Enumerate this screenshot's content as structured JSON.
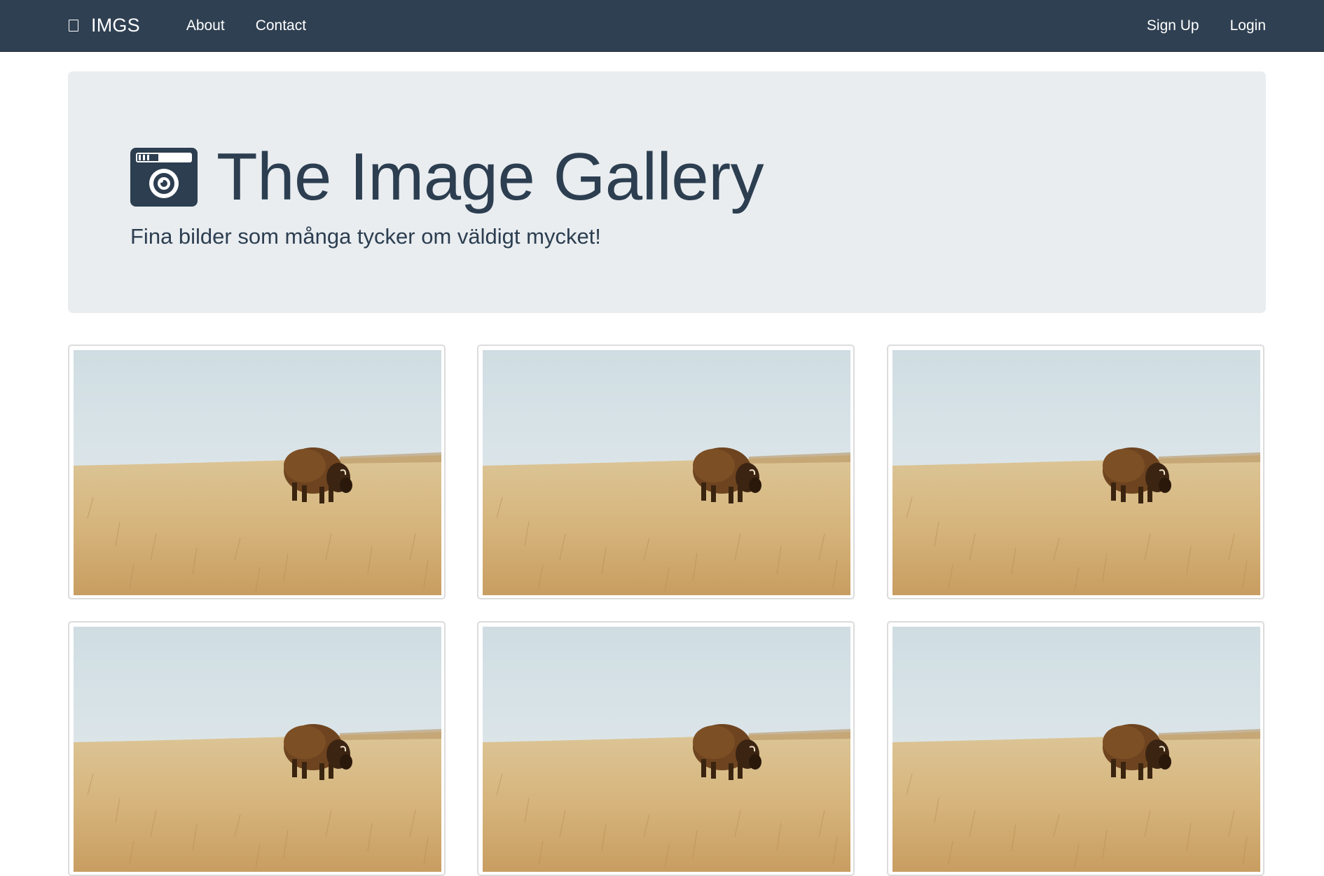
{
  "navbar": {
    "brand": "IMGS",
    "brand_icon": "image-icon",
    "links": [
      "About",
      "Contact"
    ],
    "right_links": [
      "Sign Up",
      "Login"
    ],
    "background": "#2f4052"
  },
  "jumbotron": {
    "title": "The Image Gallery",
    "title_icon": "camera-icon",
    "subtitle": "Fina bilder som många tycker om väldigt mycket!",
    "background": "#e9edf0",
    "text_color": "#2c3e50"
  },
  "gallery": {
    "thumbnail_subject": "bison-on-prairie",
    "thumbnail_count": 6
  }
}
